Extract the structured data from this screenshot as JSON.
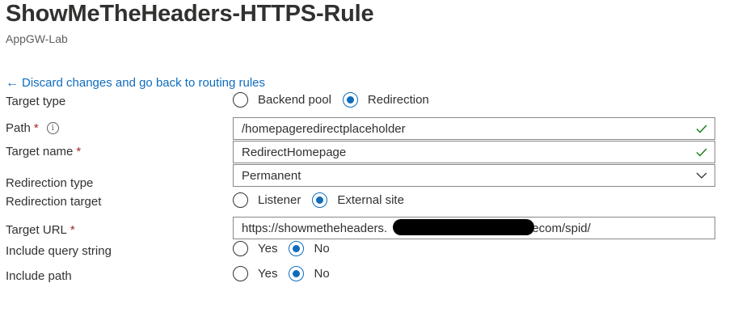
{
  "header": {
    "title": "ShowMeTheHeaders-HTTPS-Rule",
    "subtitle": "AppGW-Lab"
  },
  "back_link": {
    "arrow": "←",
    "label": "Discard changes and go back to routing rules"
  },
  "target_type": {
    "label": "Target type",
    "options": [
      "Backend pool",
      "Redirection"
    ],
    "selected": "Redirection"
  },
  "path": {
    "label": "Path",
    "required_mark": "*",
    "info_icon": "info-icon",
    "value": "/homepageredirectplaceholder"
  },
  "target_name": {
    "label": "Target name",
    "required_mark": "*",
    "value": "RedirectHomepage"
  },
  "redirection_type": {
    "label": "Redirection type",
    "value": "Permanent"
  },
  "redirection_target": {
    "label": "Redirection target",
    "options": [
      "Listener",
      "External site"
    ],
    "selected": "External site"
  },
  "target_url": {
    "label": "Target URL",
    "required_mark": "*",
    "value_prefix": "https://showmetheheaders.",
    "value_suffix": "/ecom/spid/"
  },
  "include_query_string": {
    "label": "Include query string",
    "options": [
      "Yes",
      "No"
    ],
    "selected": "No"
  },
  "include_path": {
    "label": "Include path",
    "options": [
      "Yes",
      "No"
    ],
    "selected": "No"
  },
  "colors": {
    "accent": "#0f6cbd",
    "required": "#a4262c",
    "valid_check": "#107c10"
  }
}
